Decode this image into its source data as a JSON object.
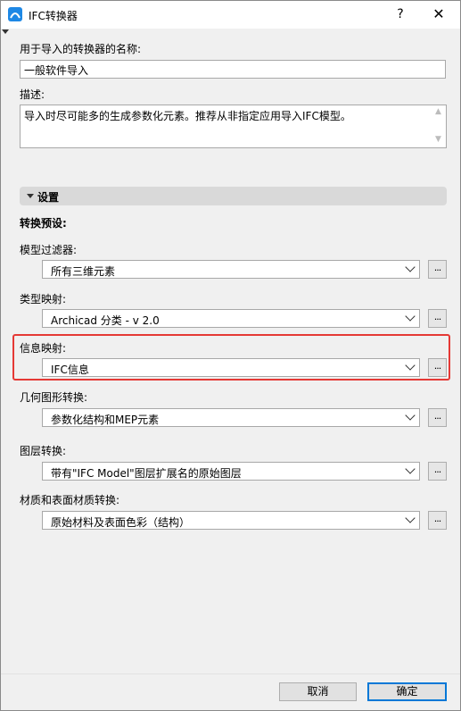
{
  "window": {
    "title": "IFC转换器",
    "help_glyph": "?",
    "close_glyph": "✕"
  },
  "name_field": {
    "label": "用于导入的转换器的名称:",
    "value": "一般软件导入"
  },
  "description": {
    "label": "描述:",
    "value": "导入时尽可能多的生成参数化元素。推荐从非指定应用导入IFC模型。"
  },
  "settings": {
    "header": "设置",
    "presets_label": "转换预设:"
  },
  "rows": [
    {
      "label": "模型过滤器:",
      "value": "所有三维元素"
    },
    {
      "label": "类型映射:",
      "value": "Archicad 分类 - v 2.0"
    },
    {
      "label": "信息映射:",
      "value": "IFC信息"
    },
    {
      "label": "几何图形转换:",
      "value": "参数化结构和MEP元素"
    },
    {
      "label": "图层转换:",
      "value": "带有\"IFC Model\"图层扩展名的原始图层"
    },
    {
      "label": "材质和表面材质转换:",
      "value": "原始材料及表面色彩（结构）"
    }
  ],
  "dots_label": "...",
  "buttons": {
    "cancel": "取消",
    "ok": "确定"
  },
  "colors": {
    "highlight": "#e53935",
    "default_button_border": "#0078d7",
    "app_icon": "#1e88e5"
  }
}
